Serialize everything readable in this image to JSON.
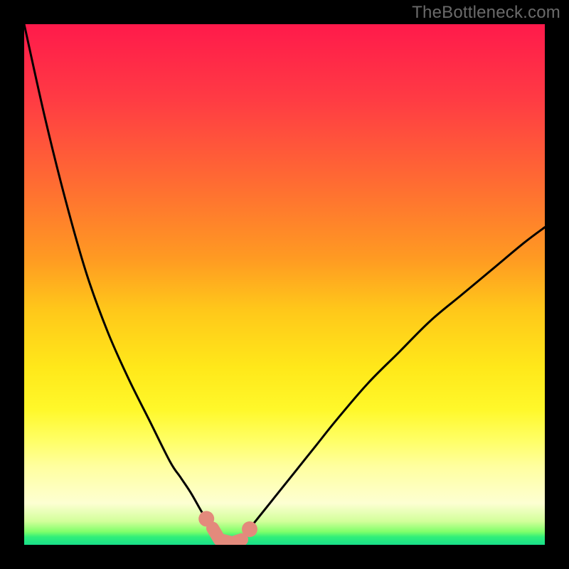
{
  "watermark": "TheBottleneck.com",
  "chart_data": {
    "type": "line",
    "title": "",
    "xlabel": "",
    "ylabel": "",
    "x_range": [
      0,
      100
    ],
    "y_range": [
      0,
      100
    ],
    "curve_left": {
      "x": [
        0,
        4,
        8,
        12,
        16,
        20,
        24,
        28,
        30,
        32,
        34,
        35,
        36,
        37,
        38
      ],
      "y": [
        100,
        82,
        66,
        52,
        41,
        32,
        24,
        16,
        13,
        10,
        6.5,
        5,
        3.5,
        2.3,
        1.3
      ]
    },
    "curve_right": {
      "x": [
        42,
        44,
        48,
        52,
        56,
        60,
        66,
        72,
        78,
        84,
        90,
        96,
        100
      ],
      "y": [
        1.5,
        4,
        9,
        14,
        19,
        24,
        31,
        37,
        43,
        48,
        53,
        58,
        61
      ]
    },
    "bottom_segment": {
      "x": [
        38,
        39,
        40,
        41,
        42
      ],
      "y": [
        1.3,
        0.6,
        0.4,
        0.6,
        1.5
      ]
    },
    "highlight_dots": [
      {
        "x": 35,
        "y": 5
      },
      {
        "x": 43.3,
        "y": 3.0
      }
    ],
    "highlight_L": [
      {
        "x": 36.2,
        "y": 3.2
      },
      {
        "x": 37.5,
        "y": 1.0
      },
      {
        "x": 40.0,
        "y": 0.4
      },
      {
        "x": 41.8,
        "y": 1.0
      }
    ],
    "good_band_y": [
      0,
      1.5
    ],
    "gradient_stops": [
      {
        "offset": 0.0,
        "color": "#ff1a4b"
      },
      {
        "offset": 0.14,
        "color": "#ff3a44"
      },
      {
        "offset": 0.3,
        "color": "#ff6a33"
      },
      {
        "offset": 0.45,
        "color": "#ff9a22"
      },
      {
        "offset": 0.55,
        "color": "#ffc81a"
      },
      {
        "offset": 0.66,
        "color": "#ffe81a"
      },
      {
        "offset": 0.74,
        "color": "#fff82a"
      },
      {
        "offset": 0.8,
        "color": "#ffff66"
      },
      {
        "offset": 0.85,
        "color": "#ffffa0"
      },
      {
        "offset": 0.92,
        "color": "#fdffd2"
      },
      {
        "offset": 0.955,
        "color": "#d2ff9a"
      },
      {
        "offset": 0.975,
        "color": "#7fff6a"
      },
      {
        "offset": 0.985,
        "color": "#30ef79"
      },
      {
        "offset": 1.0,
        "color": "#18df8a"
      }
    ],
    "highlight_color": "#e38a7c",
    "curve_color": "#000000",
    "background": "#000000"
  }
}
